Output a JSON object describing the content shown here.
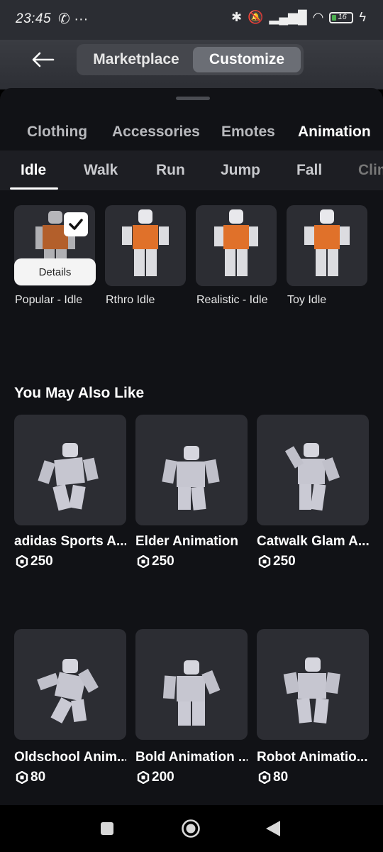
{
  "status": {
    "time": "23:45",
    "left_icons": "✆ ···",
    "battery": "16"
  },
  "top_nav": {
    "back_icon": "back-arrow-icon",
    "marketplace": "Marketplace",
    "customize": "Customize"
  },
  "categories": [
    {
      "label": "Clothing"
    },
    {
      "label": "Accessories"
    },
    {
      "label": "Emotes"
    },
    {
      "label": "Animation"
    }
  ],
  "sub_tabs": [
    {
      "label": "Idle"
    },
    {
      "label": "Walk"
    },
    {
      "label": "Run"
    },
    {
      "label": "Jump"
    },
    {
      "label": "Fall"
    },
    {
      "label": "Clim"
    }
  ],
  "animations": [
    {
      "label": "Popular - Idle",
      "selected": true,
      "details_label": "Details"
    },
    {
      "label": "Rthro Idle"
    },
    {
      "label": "Realistic - Idle"
    },
    {
      "label": "Toy Idle"
    }
  ],
  "recommend": {
    "title": "You May Also Like",
    "items": [
      {
        "name": "adidas Sports A...",
        "price": "250"
      },
      {
        "name": "Elder Animation",
        "price": "250"
      },
      {
        "name": "Catwalk Glam A...",
        "price": "250"
      },
      {
        "name": "Oldschool Anim...",
        "price": "80"
      },
      {
        "name": "Bold Animation ...",
        "price": "200"
      },
      {
        "name": "Robot Animatio...",
        "price": "80"
      }
    ]
  },
  "colors": {
    "accent_orange": "#e0712a",
    "sheet_bg": "#111216",
    "card_bg": "#2c2d33"
  }
}
